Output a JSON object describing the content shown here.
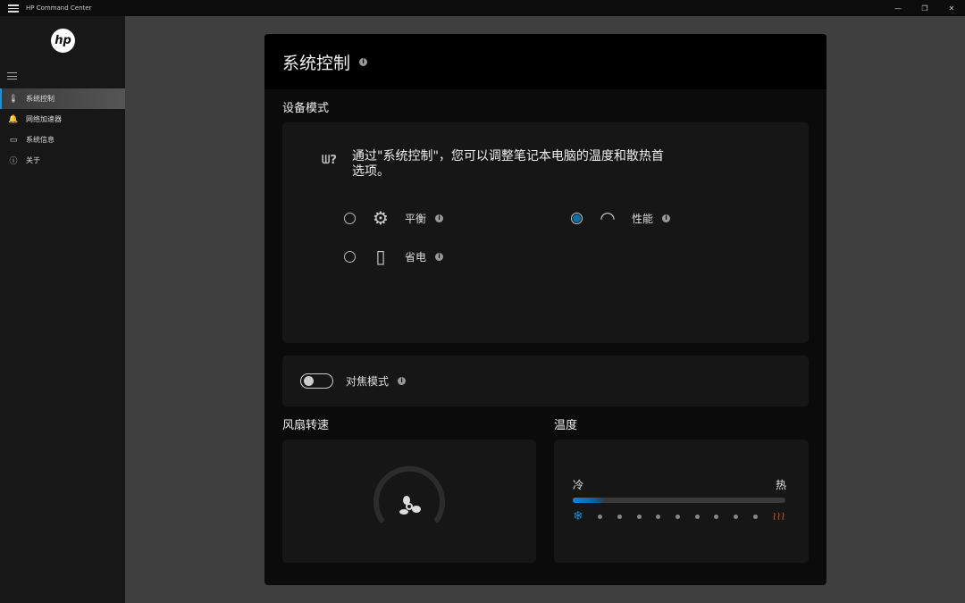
{
  "window": {
    "title": "HP Command Center",
    "minimize": "—",
    "restore": "❐",
    "close": "✕"
  },
  "sidebar": {
    "logo": "hp",
    "items": [
      {
        "label": "系统控制",
        "icon": "thermometer-icon",
        "glyph": "🌡"
      },
      {
        "label": "网络加速器",
        "icon": "bell-icon",
        "glyph": "🔔"
      },
      {
        "label": "系统信息",
        "icon": "monitor-icon",
        "glyph": "▭"
      },
      {
        "label": "关于",
        "icon": "info-icon",
        "glyph": "ⓘ"
      }
    ]
  },
  "main": {
    "title": "系统控制",
    "device_mode": {
      "label": "设备模式",
      "description": "通过\"系统控制\"，您可以调整笔记本电脑的温度和散热首选项。",
      "options": [
        {
          "label": "平衡",
          "selected": false
        },
        {
          "label": "性能",
          "selected": true
        },
        {
          "label": "省电",
          "selected": false
        }
      ]
    },
    "focus_mode": {
      "label": "对焦模式",
      "enabled": false
    },
    "fan_speed": {
      "label": "风扇转速",
      "value": 0
    },
    "temperature": {
      "label": "温度",
      "cold": "冷",
      "hot": "热",
      "value_fraction": 0.15,
      "cold_color": "#1a86d6",
      "hot_color": "#c4501f"
    }
  }
}
